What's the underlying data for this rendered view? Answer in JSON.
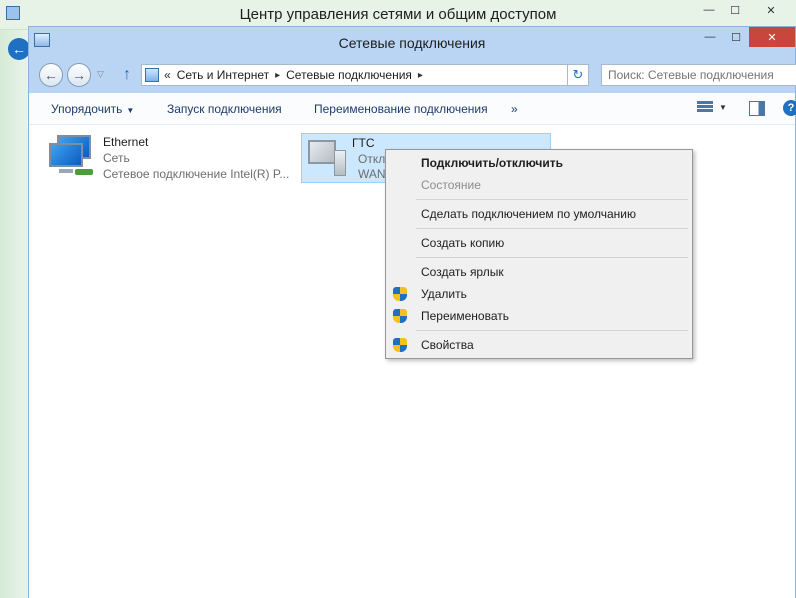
{
  "back_window": {
    "title": "Центр управления сетями и общим доступом",
    "controls": {
      "minimize": "—",
      "maximize": "☐",
      "close": "✕"
    }
  },
  "window": {
    "title": "Сетевые подключения",
    "controls": {
      "minimize": "—",
      "maximize": "☐",
      "close": "✕"
    }
  },
  "address_bar": {
    "chevron": "«",
    "crumbs": [
      "Сеть и Интернет",
      "Сетевые подключения"
    ],
    "separator": "▸",
    "dropdown": "▾",
    "refresh": "↻"
  },
  "nav": {
    "back": "←",
    "forward": "→",
    "recent": "▽",
    "up": "↑"
  },
  "search": {
    "placeholder": "Поиск: Сетевые подключения"
  },
  "command_bar": {
    "organize": "Упорядочить",
    "organize_arrow": "▼",
    "start_connection": "Запуск подключения",
    "rename_connection": "Переименование подключения",
    "more": "»",
    "view_dropdown": "▼",
    "help": "?"
  },
  "connections": [
    {
      "name": "Ethernet",
      "status": "Сеть",
      "device": "Сетевое подключение Intel(R) P..."
    },
    {
      "name": "ГТС",
      "status": "Откл",
      "device": "WAN"
    }
  ],
  "context_menu": {
    "items": [
      {
        "label": "Подключить/отключить",
        "bold": true,
        "disabled": false,
        "shield": false
      },
      {
        "label": "Состояние",
        "bold": false,
        "disabled": true,
        "shield": false
      },
      {
        "label": "Сделать подключением по умолчанию",
        "bold": false,
        "disabled": false,
        "shield": false
      },
      {
        "label": "Создать копию",
        "bold": false,
        "disabled": false,
        "shield": false
      },
      {
        "label": "Создать ярлык",
        "bold": false,
        "disabled": false,
        "shield": false
      },
      {
        "label": "Удалить",
        "bold": false,
        "disabled": false,
        "shield": true
      },
      {
        "label": "Переименовать",
        "bold": false,
        "disabled": false,
        "shield": true
      },
      {
        "label": "Свойства",
        "bold": false,
        "disabled": false,
        "shield": true
      }
    ]
  },
  "colors": {
    "titlebar": "#b9d5f3",
    "close_button": "#c9463d",
    "selection": "#cce8ff",
    "link_text": "#1e3c6a"
  }
}
